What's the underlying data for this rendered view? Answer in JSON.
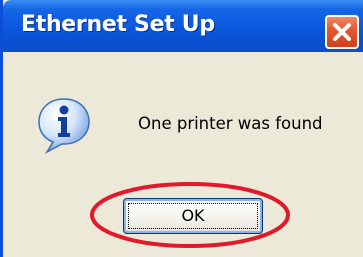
{
  "window": {
    "title": "Ethernet Set Up",
    "close_icon": "close-icon"
  },
  "message": {
    "icon": "info-icon",
    "text": "One printer was found"
  },
  "buttons": {
    "ok_label": "OK"
  },
  "annotation": {
    "shape": "ellipse",
    "color": "#e0192b",
    "target": "ok-button"
  },
  "colors": {
    "titlebar": "#0b58dc",
    "dialog_background": "#ece9d8",
    "close_button": "#e35a32"
  }
}
